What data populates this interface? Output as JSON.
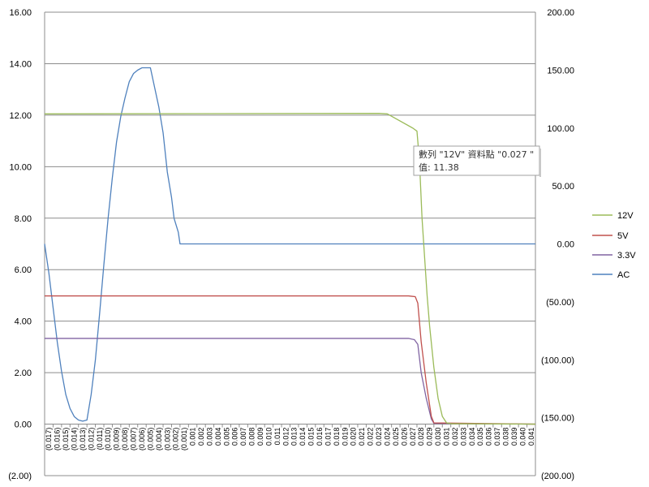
{
  "chart_data": {
    "type": "line",
    "title": "",
    "xlabel": "",
    "ylabel": "",
    "x_ticks": [
      "(0.017)",
      "(0.016)",
      "(0.015)",
      "(0.014)",
      "(0.013)",
      "(0.012)",
      "(0.011)",
      "(0.010)",
      "(0.009)",
      "(0.008)",
      "(0.007)",
      "(0.006)",
      "(0.005)",
      "(0.004)",
      "(0.003)",
      "(0.002)",
      "(0.001)",
      "0.001",
      "0.002",
      "0.003",
      "0.004",
      "0.005",
      "0.006",
      "0.007",
      "0.008",
      "0.009",
      "0.010",
      "0.011",
      "0.012",
      "0.013",
      "0.014",
      "0.015",
      "0.016",
      "0.017",
      "0.018",
      "0.019",
      "0.020",
      "0.021",
      "0.022",
      "0.023",
      "0.024",
      "0.025",
      "0.026",
      "0.027",
      "0.028",
      "0.029",
      "0.030",
      "0.031",
      "0.032",
      "0.033",
      "0.034",
      "0.035",
      "0.036",
      "0.037",
      "0.038",
      "0.039",
      "0.040",
      "0.041"
    ],
    "xlim": [
      -0.017,
      0.041
    ],
    "y_left": {
      "ylim": [
        -2,
        16
      ],
      "ticks": [
        "(2.00)",
        "0.00",
        "2.00",
        "4.00",
        "6.00",
        "8.00",
        "10.00",
        "12.00",
        "14.00",
        "16.00"
      ],
      "tick_values": [
        -2,
        0,
        2,
        4,
        6,
        8,
        10,
        12,
        14,
        16
      ]
    },
    "y_right": {
      "ylim": [
        -200,
        200
      ],
      "ticks": [
        "(200.00)",
        "(150.00)",
        "(100.00)",
        "(50.00)",
        "0.00",
        "50.00",
        "100.00",
        "150.00",
        "200.00"
      ],
      "tick_values": [
        -200,
        -150,
        -100,
        -50,
        0,
        50,
        100,
        150,
        200
      ]
    },
    "grid": "horizontal",
    "legend": "right",
    "series": [
      {
        "name": "12V",
        "axis": "left",
        "color": "#9bbb59",
        "x": [
          -0.017,
          0.0225,
          0.0235,
          0.0265,
          0.027,
          0.0273,
          0.0276,
          0.0279,
          0.0282,
          0.0285,
          0.029,
          0.0295,
          0.03,
          0.0305,
          0.031,
          0.041
        ],
        "y": [
          12.05,
          12.07,
          12.05,
          11.5,
          11.38,
          10.2,
          8.0,
          6.5,
          5.0,
          3.8,
          2.2,
          1.0,
          0.3,
          0.05,
          0.02,
          0.0
        ]
      },
      {
        "name": "5V",
        "axis": "left",
        "color": "#c0504d",
        "x": [
          -0.017,
          0.026,
          0.0268,
          0.0271,
          0.0275,
          0.0281,
          0.0287,
          0.029,
          0.041
        ],
        "y": [
          4.98,
          4.98,
          4.95,
          4.7,
          3.2,
          1.6,
          0.3,
          0.05,
          0.0
        ]
      },
      {
        "name": "3.3V",
        "axis": "left",
        "color": "#8064a2",
        "x": [
          -0.017,
          0.026,
          0.0267,
          0.0271,
          0.0275,
          0.0281,
          0.0287,
          0.029,
          0.041
        ],
        "y": [
          3.33,
          3.33,
          3.28,
          3.1,
          2.0,
          1.0,
          0.2,
          0.03,
          0.0
        ]
      },
      {
        "name": "AC",
        "axis": "right",
        "color": "#4f81bd",
        "x": [
          -0.017,
          -0.0165,
          -0.016,
          -0.0155,
          -0.015,
          -0.0145,
          -0.014,
          -0.0135,
          -0.013,
          -0.0125,
          -0.012,
          -0.0115,
          -0.011,
          -0.0105,
          -0.01,
          -0.0095,
          -0.009,
          -0.0085,
          -0.008,
          -0.0075,
          -0.007,
          -0.0065,
          -0.006,
          -0.0055,
          -0.005,
          -0.0045,
          -0.004,
          -0.0035,
          -0.003,
          -0.0025,
          -0.002,
          -0.0017,
          -0.0012,
          -0.001,
          -0.0009,
          0.0,
          0.041
        ],
        "y": [
          0,
          -25,
          -55,
          -85,
          -110,
          -130,
          -142,
          -149,
          -152,
          -153,
          -152,
          -130,
          -100,
          -60,
          -18,
          22,
          57,
          88,
          110,
          126,
          140,
          147,
          150,
          152,
          152,
          152,
          135,
          118,
          96,
          62,
          40,
          22,
          10,
          0,
          0,
          0,
          0
        ]
      }
    ]
  },
  "tooltip": {
    "line1": "數列 \"12V\" 資料點 \"0.027 \"",
    "line2": "值: 11.38"
  }
}
